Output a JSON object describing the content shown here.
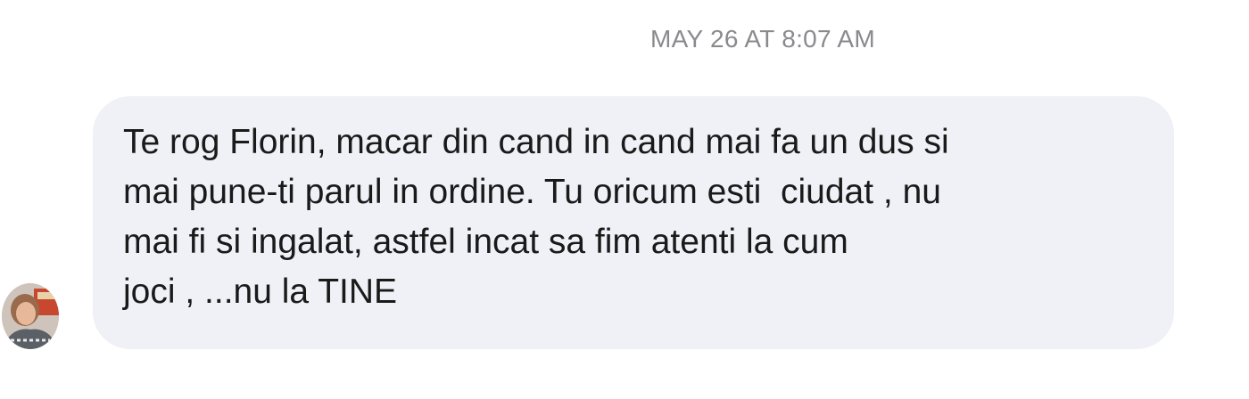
{
  "conversation": {
    "timestamp": "MAY 26 AT 8:07 AM",
    "message": {
      "sender_avatar_icon": "user-avatar",
      "text": "Te rog Florin, macar din cand in cand mai fa un dus si\nmai pune-ti parul in ordine. Tu oricum esti  ciudat , nu\nmai fi si ingalat, astfel incat sa fim atenti la cum\njoci , ...nu la TINE"
    }
  },
  "colors": {
    "bubble_background": "#f0f1f6",
    "timestamp_text": "#8a8a8e",
    "message_text": "#1a1a1a"
  }
}
